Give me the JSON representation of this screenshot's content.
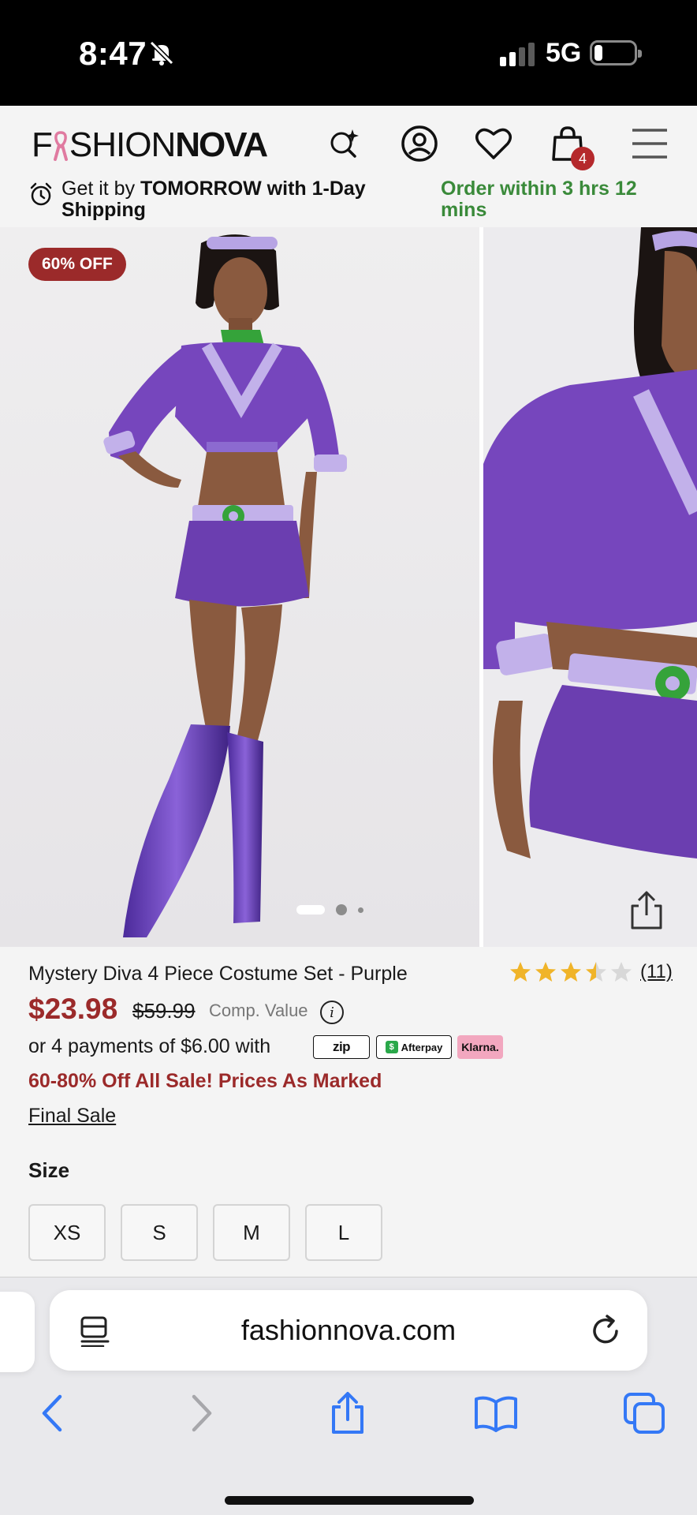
{
  "status_bar": {
    "time": "8:47",
    "network": "5G",
    "icons": [
      "bell-slash-icon",
      "signal-icon",
      "battery-icon"
    ]
  },
  "header": {
    "logo_prefix": "F",
    "logo_light": "SHION",
    "logo_bold": "NOVA",
    "cart_count": "4",
    "icons": [
      "ai-search-icon",
      "account-icon",
      "heart-icon",
      "cart-icon",
      "menu-icon"
    ]
  },
  "shipping": {
    "line_pre": "Get it by ",
    "line_bold": "TOMORROW",
    "line_post": " with 1-Day Shipping",
    "order_within": "Order within 3 hrs 12 mins"
  },
  "gallery": {
    "discount_badge": "60% OFF",
    "slide_count": 3,
    "active_slide": 1
  },
  "product": {
    "title": "Mystery Diva 4 Piece Costume Set - Purple",
    "rating": 3.5,
    "rating_max": 5,
    "review_count": "(11)",
    "price": "$23.98",
    "compare_price": "$59.99",
    "compare_label": "Comp. Value",
    "info_glyph": "i",
    "installments": "or 4 payments of $6.00 with",
    "payment_providers": {
      "zip": "zip",
      "afterpay": "Afterpay",
      "afterpay_mark": "$",
      "klarna": "Klarna."
    },
    "sale_banner": "60-80% Off All Sale! Prices As Marked",
    "final_sale": "Final Sale",
    "size_label": "Size",
    "sizes": [
      "XS",
      "S",
      "M",
      "L"
    ]
  },
  "browser": {
    "url": "fashionnova.com",
    "icons": [
      "reader-icon",
      "reload-icon",
      "back-icon",
      "forward-icon",
      "share-icon",
      "bookmarks-icon",
      "tabs-icon"
    ]
  },
  "colors": {
    "brand_red": "#9b2a2a",
    "ship_green": "#3a8a3a",
    "star_gold": "#f0b429",
    "ios_blue": "#3478f6"
  }
}
